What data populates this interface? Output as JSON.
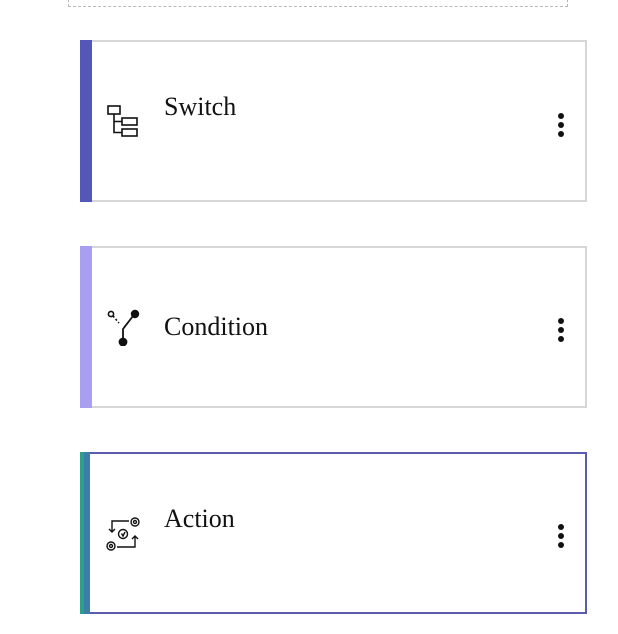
{
  "cards": [
    {
      "title": "Switch",
      "icon": "switch-icon",
      "accent": "#5357b8"
    },
    {
      "title": "Condition",
      "icon": "condition-branch-icon",
      "accent": "#a89ff0"
    },
    {
      "title": "Action",
      "icon": "action-gears-icon",
      "accent": "#3a7fa6",
      "accent_secondary": "#2f9e8c",
      "selected_border": "#5b5cae"
    }
  ]
}
